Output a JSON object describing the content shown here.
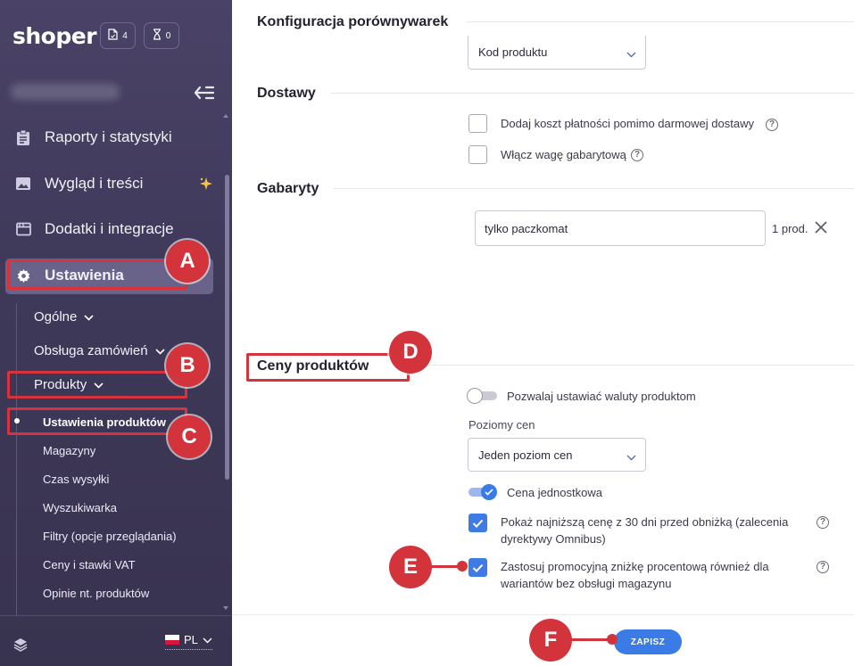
{
  "sidebar": {
    "logo": "shoper",
    "badges": [
      {
        "icon": "document-icon",
        "count": "4"
      },
      {
        "icon": "hourglass-icon",
        "count": "0"
      }
    ],
    "menu": [
      {
        "label": "Raporty i statystyki",
        "icon": "clipboard-icon"
      },
      {
        "label": "Wygląd i treści",
        "icon": "image-icon",
        "badge_icon": "sparkle-icon"
      },
      {
        "label": "Dodatki i integracje",
        "icon": "window-icon"
      },
      {
        "label": "Ustawienia",
        "icon": "gear-icon",
        "active": true
      }
    ],
    "submenu": [
      {
        "label": "Ogólne"
      },
      {
        "label": "Obsługa zamówień"
      },
      {
        "label": "Produkty"
      }
    ],
    "subsubmenu": [
      {
        "label": "Ustawienia produktów",
        "active": true
      },
      {
        "label": "Magazyny"
      },
      {
        "label": "Czas wysyłki"
      },
      {
        "label": "Wyszukiwarka"
      },
      {
        "label": "Filtry (opcje przeglądania)"
      },
      {
        "label": "Ceny i stawki VAT"
      },
      {
        "label": "Opinie nt. produktów"
      }
    ],
    "language": "PL"
  },
  "main": {
    "comparison": {
      "title": "Konfiguracja porównywarek",
      "select_value": "Kod produktu"
    },
    "shipping": {
      "title": "Dostawy",
      "options": [
        {
          "label": "Dodaj koszt płatności pomimo darmowej dostawy",
          "checked": false
        },
        {
          "label": "Włącz wagę gabarytową",
          "checked": false
        }
      ]
    },
    "dimensions": {
      "title": "Gabaryty",
      "input_value": "tylko paczkomat",
      "count_label": "1 prod."
    },
    "prices": {
      "title": "Ceny produktów",
      "currency_toggle_label": "Pozwalaj ustawiać waluty produktom",
      "currency_toggle_on": false,
      "levels_label": "Poziomy cen",
      "levels_value": "Jeden poziom cen",
      "unit_price_label": "Cena jednostkowa",
      "unit_price_on": true,
      "omnibus_line1": "Pokaż najniższą cenę z 30 dni przed obniżką (zalecenia",
      "omnibus_line2": "dyrektywy Omnibus)",
      "promo_line1": "Zastosuj promocyjną zniżkę procentową również dla",
      "promo_line2": "wariantów bez obsługi magazynu"
    },
    "save_label": "ZAPISZ"
  },
  "annotations": {
    "a": "A",
    "b": "B",
    "c": "C",
    "d": "D",
    "e": "E",
    "f": "F"
  },
  "colors": {
    "accent": "#3a7be6",
    "annotation": "#d3343c",
    "sidebar_bg": "#433d60"
  }
}
